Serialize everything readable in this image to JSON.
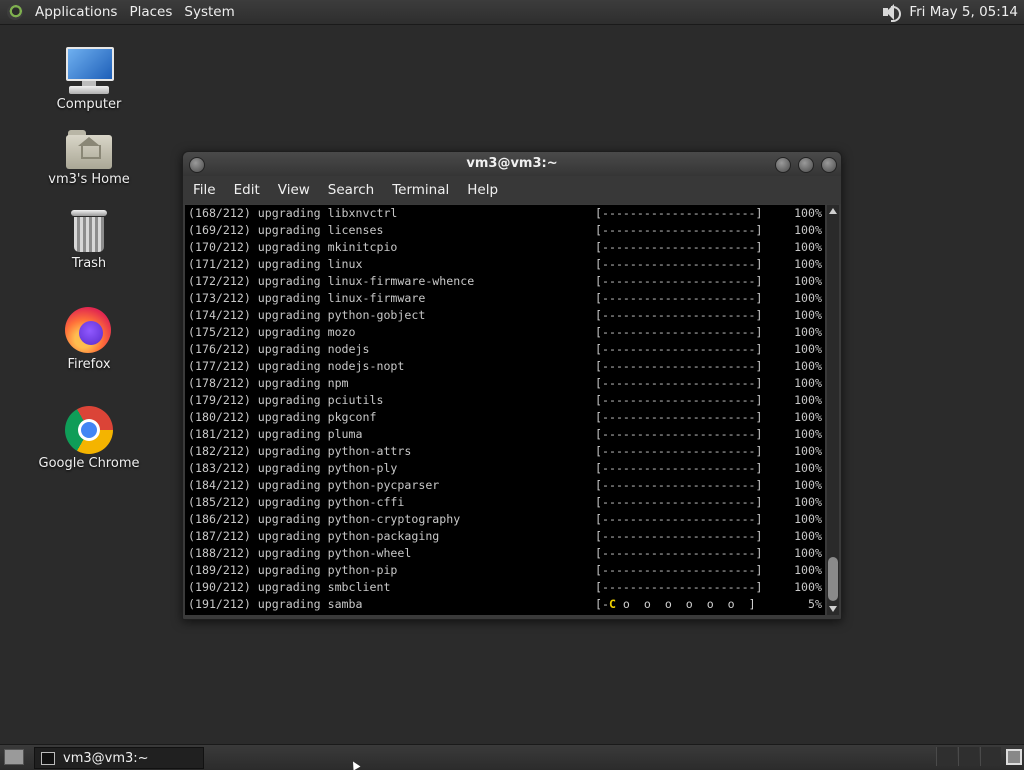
{
  "top_panel": {
    "menus": [
      "Applications",
      "Places",
      "System"
    ],
    "clock": "Fri May  5, 05:14",
    "icons": [
      "distro-logo-icon",
      "volume-icon"
    ]
  },
  "desktop_icons": [
    {
      "label": "Computer",
      "icon": "computer-icon"
    },
    {
      "label": "vm3's Home",
      "icon": "home-folder-icon"
    },
    {
      "label": "Trash",
      "icon": "trash-icon"
    },
    {
      "label": "Firefox",
      "icon": "firefox-icon"
    },
    {
      "label": "Google Chrome",
      "icon": "chrome-icon"
    }
  ],
  "terminal": {
    "title": "vm3@vm3:~",
    "menu": [
      "File",
      "Edit",
      "View",
      "Search",
      "Terminal",
      "Help"
    ],
    "lines": [
      {
        "step": "(168/212) upgrading libxnvctrl",
        "bar": "[----------------------]",
        "pct": "100%"
      },
      {
        "step": "(169/212) upgrading licenses",
        "bar": "[----------------------]",
        "pct": "100%"
      },
      {
        "step": "(170/212) upgrading mkinitcpio",
        "bar": "[----------------------]",
        "pct": "100%"
      },
      {
        "step": "(171/212) upgrading linux",
        "bar": "[----------------------]",
        "pct": "100%"
      },
      {
        "step": "(172/212) upgrading linux-firmware-whence",
        "bar": "[----------------------]",
        "pct": "100%"
      },
      {
        "step": "(173/212) upgrading linux-firmware",
        "bar": "[----------------------]",
        "pct": "100%"
      },
      {
        "step": "(174/212) upgrading python-gobject",
        "bar": "[----------------------]",
        "pct": "100%"
      },
      {
        "step": "(175/212) upgrading mozo",
        "bar": "[----------------------]",
        "pct": "100%"
      },
      {
        "step": "(176/212) upgrading nodejs",
        "bar": "[----------------------]",
        "pct": "100%"
      },
      {
        "step": "(177/212) upgrading nodejs-nopt",
        "bar": "[----------------------]",
        "pct": "100%"
      },
      {
        "step": "(178/212) upgrading npm",
        "bar": "[----------------------]",
        "pct": "100%"
      },
      {
        "step": "(179/212) upgrading pciutils",
        "bar": "[----------------------]",
        "pct": "100%"
      },
      {
        "step": "(180/212) upgrading pkgconf",
        "bar": "[----------------------]",
        "pct": "100%"
      },
      {
        "step": "(181/212) upgrading pluma",
        "bar": "[----------------------]",
        "pct": "100%"
      },
      {
        "step": "(182/212) upgrading python-attrs",
        "bar": "[----------------------]",
        "pct": "100%"
      },
      {
        "step": "(183/212) upgrading python-ply",
        "bar": "[----------------------]",
        "pct": "100%"
      },
      {
        "step": "(184/212) upgrading python-pycparser",
        "bar": "[----------------------]",
        "pct": "100%"
      },
      {
        "step": "(185/212) upgrading python-cffi",
        "bar": "[----------------------]",
        "pct": "100%"
      },
      {
        "step": "(186/212) upgrading python-cryptography",
        "bar": "[----------------------]",
        "pct": "100%"
      },
      {
        "step": "(187/212) upgrading python-packaging",
        "bar": "[----------------------]",
        "pct": "100%"
      },
      {
        "step": "(188/212) upgrading python-wheel",
        "bar": "[----------------------]",
        "pct": "100%"
      },
      {
        "step": "(189/212) upgrading python-pip",
        "bar": "[----------------------]",
        "pct": "100%"
      },
      {
        "step": "(190/212) upgrading smbclient",
        "bar": "[----------------------]",
        "pct": "100%"
      },
      {
        "step": "(191/212) upgrading samba",
        "bar_open": "[-",
        "bar_pac": "C",
        "bar_rest": " o  o  o  o  o  o  ]",
        "pct": "5%"
      }
    ]
  },
  "taskbar": {
    "task_label": "vm3@vm3:~",
    "icons": [
      "show-desktop-icon",
      "terminal-icon"
    ]
  }
}
